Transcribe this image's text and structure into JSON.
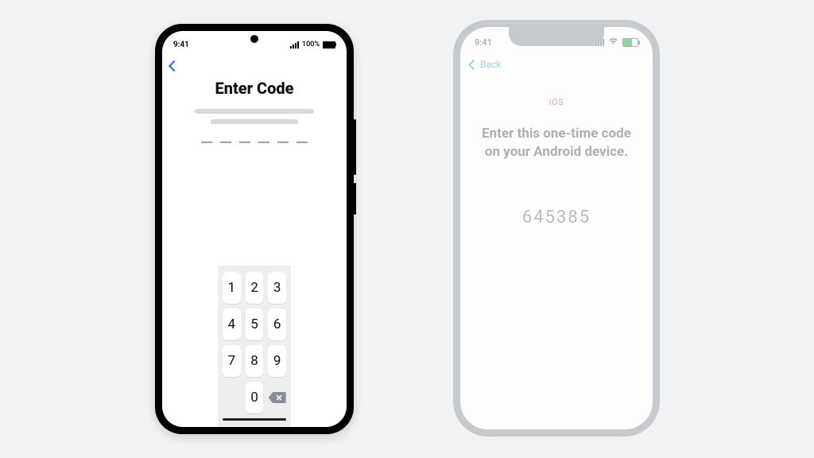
{
  "android": {
    "status_time": "9:41",
    "status_battery_label": "100%",
    "title": "Enter Code",
    "code_length": 6,
    "keypad": {
      "k1": "1",
      "k2": "2",
      "k3": "3",
      "k4": "4",
      "k5": "5",
      "k6": "6",
      "k7": "7",
      "k8": "8",
      "k9": "9",
      "k0": "0"
    }
  },
  "iphone": {
    "status_time": "9:41",
    "back_label": "Back",
    "subheader": "iOS",
    "instruction": "Enter this one-time code on your Android device.",
    "code": "645385"
  }
}
